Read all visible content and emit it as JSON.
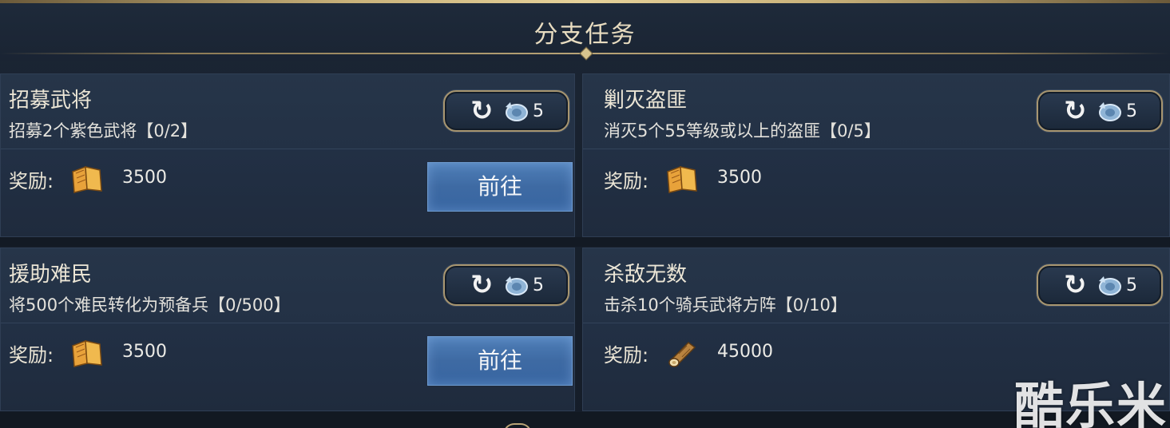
{
  "header": {
    "title": "分支任务"
  },
  "tasks": [
    {
      "name": "招募武将",
      "description": "招募2个紫色武将【0/2】",
      "refresh_cost": "5",
      "reward_label": "奖励:",
      "reward_icon": "book-icon",
      "reward_value": "3500",
      "go_label": "前往",
      "has_go_button": true
    },
    {
      "name": "剿灭盗匪",
      "description": "消灭5个55等级或以上的盗匪【0/5】",
      "refresh_cost": "5",
      "reward_label": "奖励:",
      "reward_icon": "book-icon",
      "reward_value": "3500",
      "has_go_button": false
    },
    {
      "name": "援助难民",
      "description": "将500个难民转化为预备兵【0/500】",
      "refresh_cost": "5",
      "reward_label": "奖励:",
      "reward_icon": "book-icon",
      "reward_value": "3500",
      "go_label": "前往",
      "has_go_button": true
    },
    {
      "name": "杀敌无数",
      "description": "击杀10个骑兵武将方阵【0/10】",
      "refresh_cost": "5",
      "reward_label": "奖励:",
      "reward_icon": "wood-log-icon",
      "reward_value": "45000",
      "has_go_button": false
    }
  ],
  "watermark": "酷乐米",
  "colors": {
    "title_text": "#e8dcc0",
    "gold_border": "#a89670",
    "go_button": "#3e6aa3",
    "panel_bg": "#223045"
  }
}
